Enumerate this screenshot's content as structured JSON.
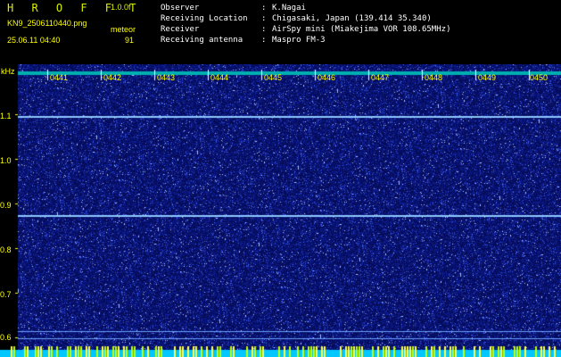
{
  "header": {
    "app_title": "H R O F F T",
    "version": "1.0.0f",
    "filename": "KN9_2506110440.png",
    "mode": "meteor",
    "datetime": "25.06.11 04:40",
    "count": "91"
  },
  "info": [
    {
      "key": "Observer",
      "value": "K.Nagai"
    },
    {
      "key": "Receiving Location",
      "value": "Chigasaki, Japan (139.414 35.340)"
    },
    {
      "key": "Receiver",
      "value": "AirSpy mini (Miakejima VOR 108.65MHz)"
    },
    {
      "key": "Receiving antenna",
      "value": "Maspro FM-3"
    }
  ],
  "plot": {
    "y_unit": "kHz",
    "y_ticks": [
      "1.1",
      "1.0",
      "0.9",
      "0.8",
      "0.7",
      "0.6"
    ],
    "time_ticks": [
      "0441",
      "0442",
      "0443",
      "0444",
      "0445",
      "0446",
      "0447",
      "0448",
      "0449",
      "0450"
    ],
    "colors": {
      "background": "#000000",
      "noise_base": "#0a1a7a",
      "noise_bright": "#4060ff",
      "carrier_line": "#9ad0ff",
      "axis_text": "#ffff00",
      "top_band": "#00c8c8",
      "bottom_band": "#00d8ff"
    }
  }
}
